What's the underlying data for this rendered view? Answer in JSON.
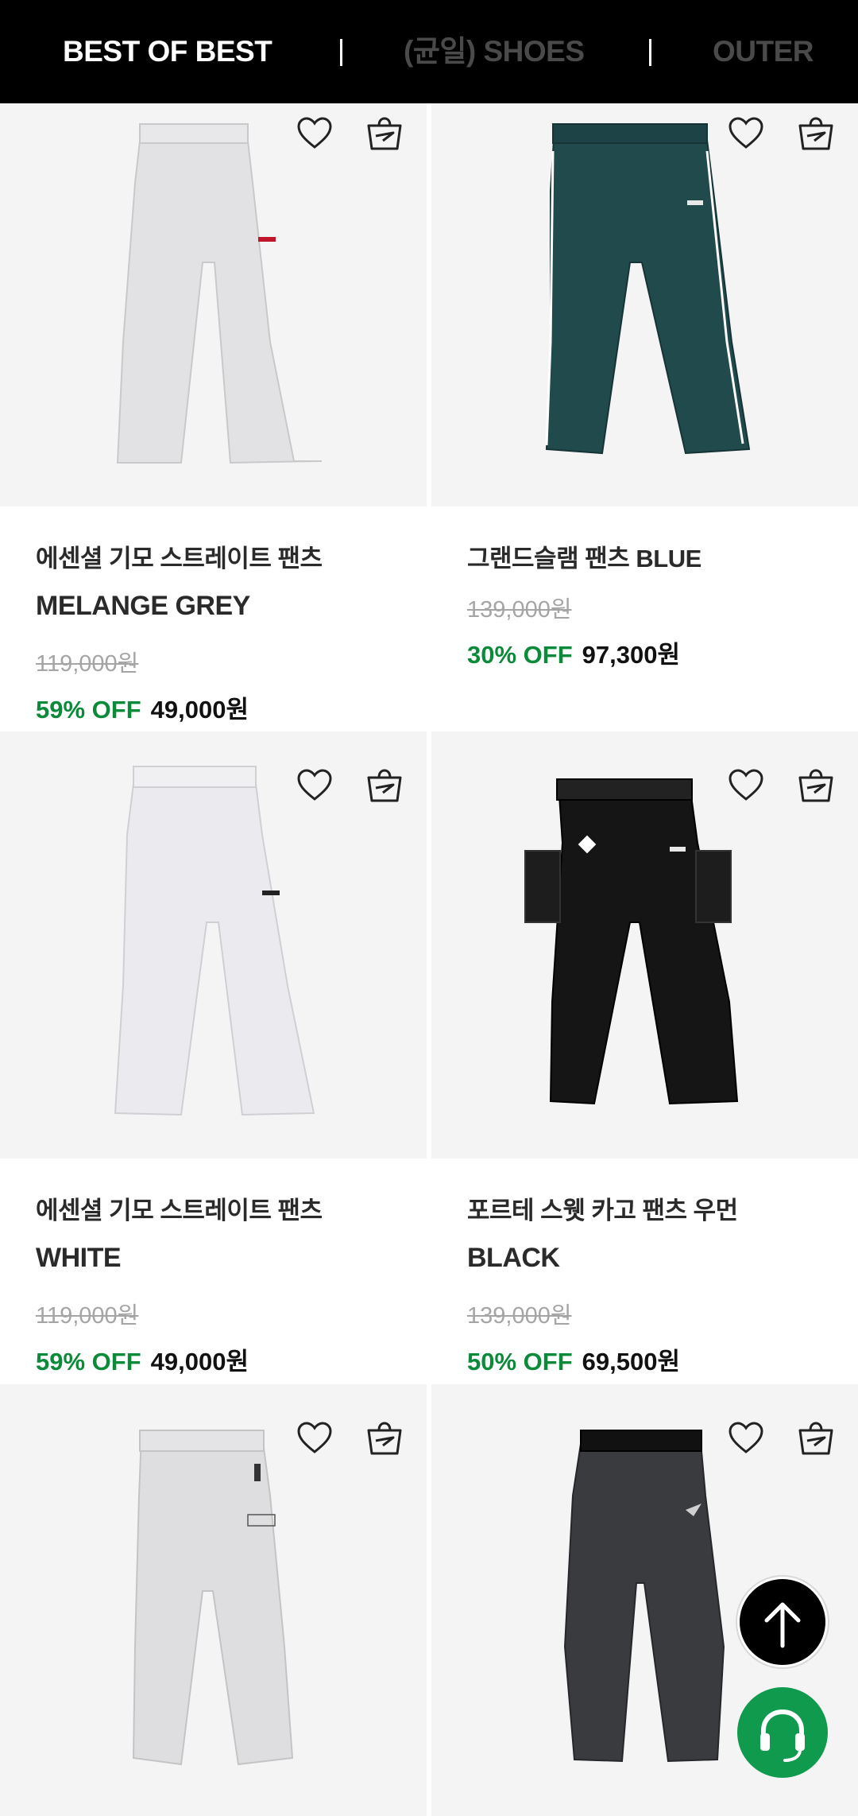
{
  "nav": {
    "tabs": [
      {
        "label": "BEST OF BEST",
        "active": true
      },
      {
        "label": "(균일) SHOES",
        "active": false
      },
      {
        "label": "OUTER",
        "active": false
      }
    ]
  },
  "products": [
    {
      "name": "에센셜 기모 스트레이트 팬츠",
      "color": "MELANGE GREY",
      "original_price": "119,000원",
      "discount": "59% OFF",
      "price": "49,000원",
      "pants_color": "#e2e2e4"
    },
    {
      "name": "그랜드슬램 팬츠 BLUE",
      "color": "",
      "original_price": "139,000원",
      "discount": "30% OFF",
      "price": "97,300원",
      "pants_color": "#214a4d"
    },
    {
      "name": "에센셜 기모 스트레이트 팬츠",
      "color": "WHITE",
      "original_price": "119,000원",
      "discount": "59% OFF",
      "price": "49,000원",
      "pants_color": "#ebebef"
    },
    {
      "name": "포르테 스웻 카고 팬츠 우먼",
      "color": "BLACK",
      "original_price": "139,000원",
      "discount": "50% OFF",
      "price": "69,500원",
      "pants_color": "#151515"
    },
    {
      "name": "",
      "color": "",
      "original_price": "",
      "discount": "",
      "price": "",
      "pants_color": "#dedee0"
    },
    {
      "name": "",
      "color": "",
      "original_price": "",
      "discount": "",
      "price": "",
      "pants_color": "#3a3b3f"
    }
  ],
  "icons": {
    "wishlist": "heart-icon",
    "cart": "shopping-bag-icon",
    "scroll_top": "arrow-up-icon",
    "support": "headset-icon"
  },
  "colors": {
    "discount": "#0b8a3a",
    "header_bg": "#000000",
    "image_bg": "#f4f4f4",
    "support_button": "#0f9a4e"
  }
}
